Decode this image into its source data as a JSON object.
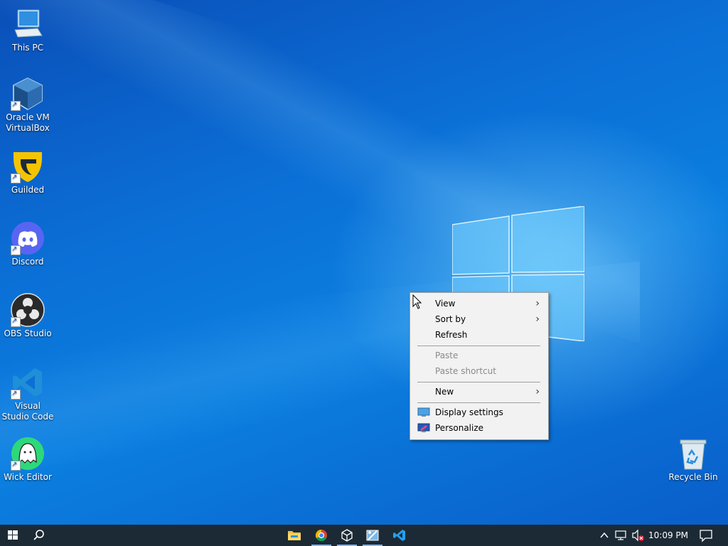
{
  "desktop_icons": [
    {
      "label": "This PC"
    },
    {
      "label": "Oracle VM VirtualBox"
    },
    {
      "label": "Guilded"
    },
    {
      "label": "Discord"
    },
    {
      "label": "OBS Studio"
    },
    {
      "label": "Visual Studio Code"
    },
    {
      "label": "Wick Editor"
    },
    {
      "label": "Recycle Bin"
    }
  ],
  "context_menu": {
    "view": "View",
    "sort_by": "Sort by",
    "refresh": "Refresh",
    "paste": "Paste",
    "paste_shortcut": "Paste shortcut",
    "new": "New",
    "display_settings": "Display settings",
    "personalize": "Personalize"
  },
  "taskbar": {
    "pinned_apps": [
      "file-explorer-icon",
      "chrome-icon",
      "virtualbox-icon",
      "snipping-tool-icon",
      "vscode-icon"
    ],
    "time": "10:09 PM"
  },
  "colors": {
    "desktop_blue": "#0b6fd6",
    "taskbar_bg": "#1c2a36",
    "menu_bg": "#f2f2f2",
    "running_indicator": "#8ab4e0"
  }
}
